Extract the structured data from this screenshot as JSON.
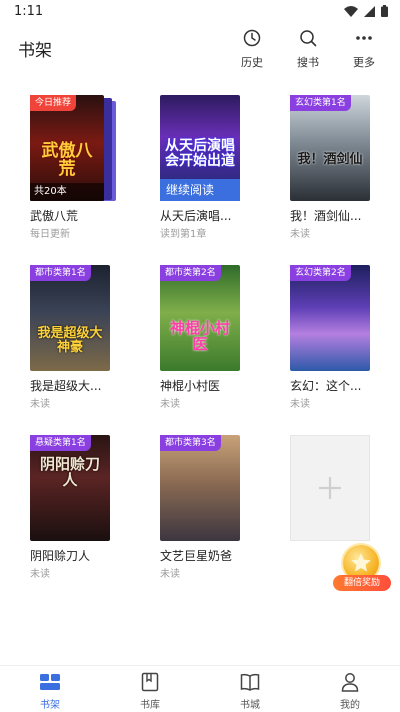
{
  "status_bar": {
    "time": "1:11"
  },
  "header": {
    "title": "书架",
    "actions": [
      {
        "label": "历史",
        "icon": "clock-icon"
      },
      {
        "label": "搜书",
        "icon": "search-icon"
      },
      {
        "label": "更多",
        "icon": "more-icon"
      }
    ]
  },
  "books": [
    {
      "badge": "今日推荐",
      "badge_color": "#f0443a",
      "cover_text": "武傲八荒",
      "cover_footer": "共20本",
      "title": "武傲八荒",
      "subtitle": "每日更新"
    },
    {
      "badge": "",
      "cover_text": "从天后演唱会开始出道",
      "cover_footer": "继续阅读",
      "title": "从天后演唱...",
      "subtitle": "读到第1章"
    },
    {
      "badge": "玄幻类第1名",
      "badge_color": "#8a3fe0",
      "cover_text": "我！酒剑仙",
      "title": "我！酒剑仙...",
      "subtitle": "未读"
    },
    {
      "badge": "都市类第1名",
      "badge_color": "#8a3fe0",
      "cover_text": "我是超级大神豪",
      "title": "我是超级大...",
      "subtitle": "未读"
    },
    {
      "badge": "都市类第2名",
      "badge_color": "#8a3fe0",
      "cover_text": "神棍小村医",
      "title": "神棍小村医",
      "subtitle": "未读"
    },
    {
      "badge": "玄幻类第2名",
      "badge_color": "#8a3fe0",
      "cover_text": "",
      "title": "玄幻：这个...",
      "subtitle": "未读"
    },
    {
      "badge": "悬疑类第1名",
      "badge_color": "#8a3fe0",
      "cover_text": "阴阳赊刀人",
      "title": "阴阳赊刀人",
      "subtitle": "未读"
    },
    {
      "badge": "都市类第3名",
      "badge_color": "#8a3fe0",
      "cover_text": "",
      "title": "文艺巨星奶爸",
      "subtitle": "未读"
    }
  ],
  "reward": {
    "label": "翻倍奖励"
  },
  "bottom_nav": [
    {
      "label": "书架",
      "icon": "bookshelf-icon",
      "active": true
    },
    {
      "label": "书库",
      "icon": "library-icon",
      "active": false
    },
    {
      "label": "书城",
      "icon": "bookstore-icon",
      "active": false
    },
    {
      "label": "我的",
      "icon": "profile-icon",
      "active": false
    }
  ],
  "colors": {
    "accent": "#3b6fe0",
    "badge_purple": "#8a3fe0",
    "badge_red": "#f0443a"
  }
}
